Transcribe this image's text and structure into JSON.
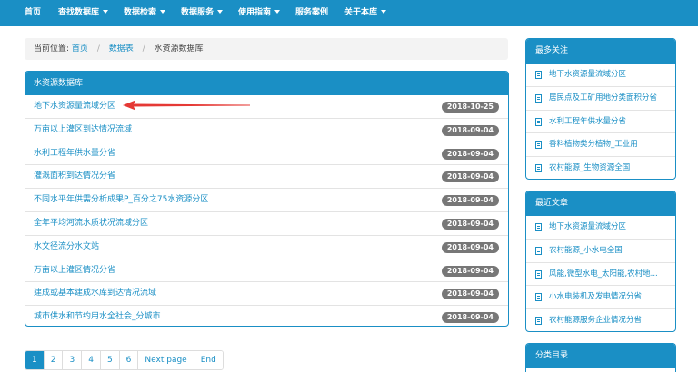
{
  "nav": {
    "items": [
      {
        "label": "首页",
        "dropdown": false
      },
      {
        "label": "查找数据库",
        "dropdown": true
      },
      {
        "label": "数据检索",
        "dropdown": true
      },
      {
        "label": "数据服务",
        "dropdown": true
      },
      {
        "label": "使用指南",
        "dropdown": true
      },
      {
        "label": "服务案例",
        "dropdown": false
      },
      {
        "label": "关于本库",
        "dropdown": true
      }
    ]
  },
  "breadcrumb": {
    "prefix": "当前位置:",
    "items": [
      "首页",
      "数据表",
      "水资源数据库"
    ],
    "separator": "/"
  },
  "main_panel": {
    "title": "水资源数据库",
    "rows": [
      {
        "title": "地下水资源量流域分区",
        "date": "2018-10-25"
      },
      {
        "title": "万亩以上灌区到达情况流域",
        "date": "2018-09-04"
      },
      {
        "title": "水利工程年供水量分省",
        "date": "2018-09-04"
      },
      {
        "title": "灌溉面积到达情况分省",
        "date": "2018-09-04"
      },
      {
        "title": "不同水平年供需分析成果P_百分之75水资源分区",
        "date": "2018-09-04"
      },
      {
        "title": "全年平均河流水质状况流域分区",
        "date": "2018-09-04"
      },
      {
        "title": "水文径流分水文站",
        "date": "2018-09-04"
      },
      {
        "title": "万亩以上灌区情况分省",
        "date": "2018-09-04"
      },
      {
        "title": "建成或基本建成水库到达情况流域",
        "date": "2018-09-04"
      },
      {
        "title": "城市供水和节约用水全社会_分城市",
        "date": "2018-09-04"
      }
    ]
  },
  "pagination": [
    "1",
    "2",
    "3",
    "4",
    "5",
    "6",
    "Next page",
    "End"
  ],
  "pagination_active": "1",
  "sidebar": {
    "most_followed": {
      "title": "最多关注",
      "items": [
        "地下水资源量流域分区",
        "居民点及工矿用地分类面积分省",
        "水利工程年供水量分省",
        "香料植物类分植物_工业用",
        "农村能源_生物资源全国"
      ]
    },
    "recent_articles": {
      "title": "最近文章",
      "items": [
        "地下水资源量流域分区",
        "农村能源_小水电全国",
        "风能,微型水电_太阳能,农村地...",
        "小水电装机及发电情况分省",
        "农村能源服务企业情况分省"
      ]
    },
    "categories": {
      "title": "分类目录"
    }
  },
  "colors": {
    "primary": "#1a8fc5",
    "badge": "#777777",
    "arrow": "#e53935"
  },
  "icons": {
    "nav_caret": "caret-down-icon",
    "list_item": "document-icon",
    "annotation": "red-arrow-icon"
  }
}
